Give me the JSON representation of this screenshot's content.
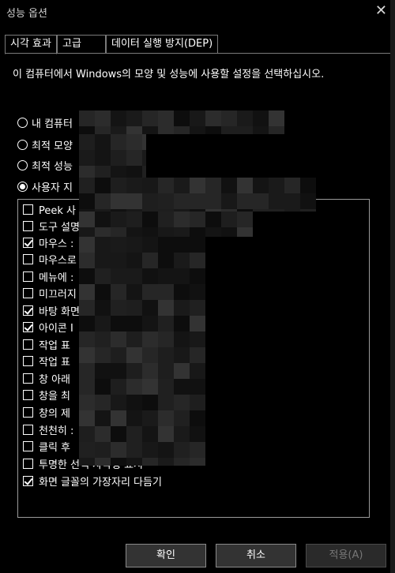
{
  "window": {
    "title": "성능 옵션",
    "close_glyph": "✕"
  },
  "tabs": [
    {
      "label": "시각 효과",
      "active": true
    },
    {
      "label": "고급",
      "active": false
    },
    {
      "label": "데이터 실행 방지(DEP)",
      "active": false
    }
  ],
  "description": "이 컴퓨터에서 Windows의 모양 및 성능에 사용할 설정을 선택하십시오.",
  "radios": [
    {
      "label": "내 컴퓨터",
      "checked": false
    },
    {
      "label": "최적 모양",
      "checked": false
    },
    {
      "label": "최적 성능",
      "checked": false
    },
    {
      "label": "사용자 지",
      "checked": true
    }
  ],
  "options": [
    {
      "label": "Peek 사",
      "checked": false
    },
    {
      "label": "도구 설명",
      "checked": false
    },
    {
      "label": "마우스 :",
      "checked": true
    },
    {
      "label": "마우스로",
      "checked": false
    },
    {
      "label": "메뉴에 :",
      "checked": false
    },
    {
      "label": "미끄러지",
      "checked": false
    },
    {
      "label": "바탕 화면",
      "checked": true
    },
    {
      "label": "아이콘 I",
      "checked": true
    },
    {
      "label": "작업 표",
      "checked": false
    },
    {
      "label": "작업 표",
      "checked": false
    },
    {
      "label": "창 아래",
      "checked": false
    },
    {
      "label": "창을 최",
      "checked": false
    },
    {
      "label": "창의 제",
      "checked": false
    },
    {
      "label": "천천히 :",
      "checked": false
    },
    {
      "label": "클릭 후",
      "checked": false
    },
    {
      "label": "투명한 선택 사각형 표시",
      "checked": false
    },
    {
      "label": "화면 글꼴의 가장자리 다듬기",
      "checked": true
    }
  ],
  "buttons": {
    "ok": "확인",
    "cancel": "취소",
    "apply": "적용(A)"
  }
}
